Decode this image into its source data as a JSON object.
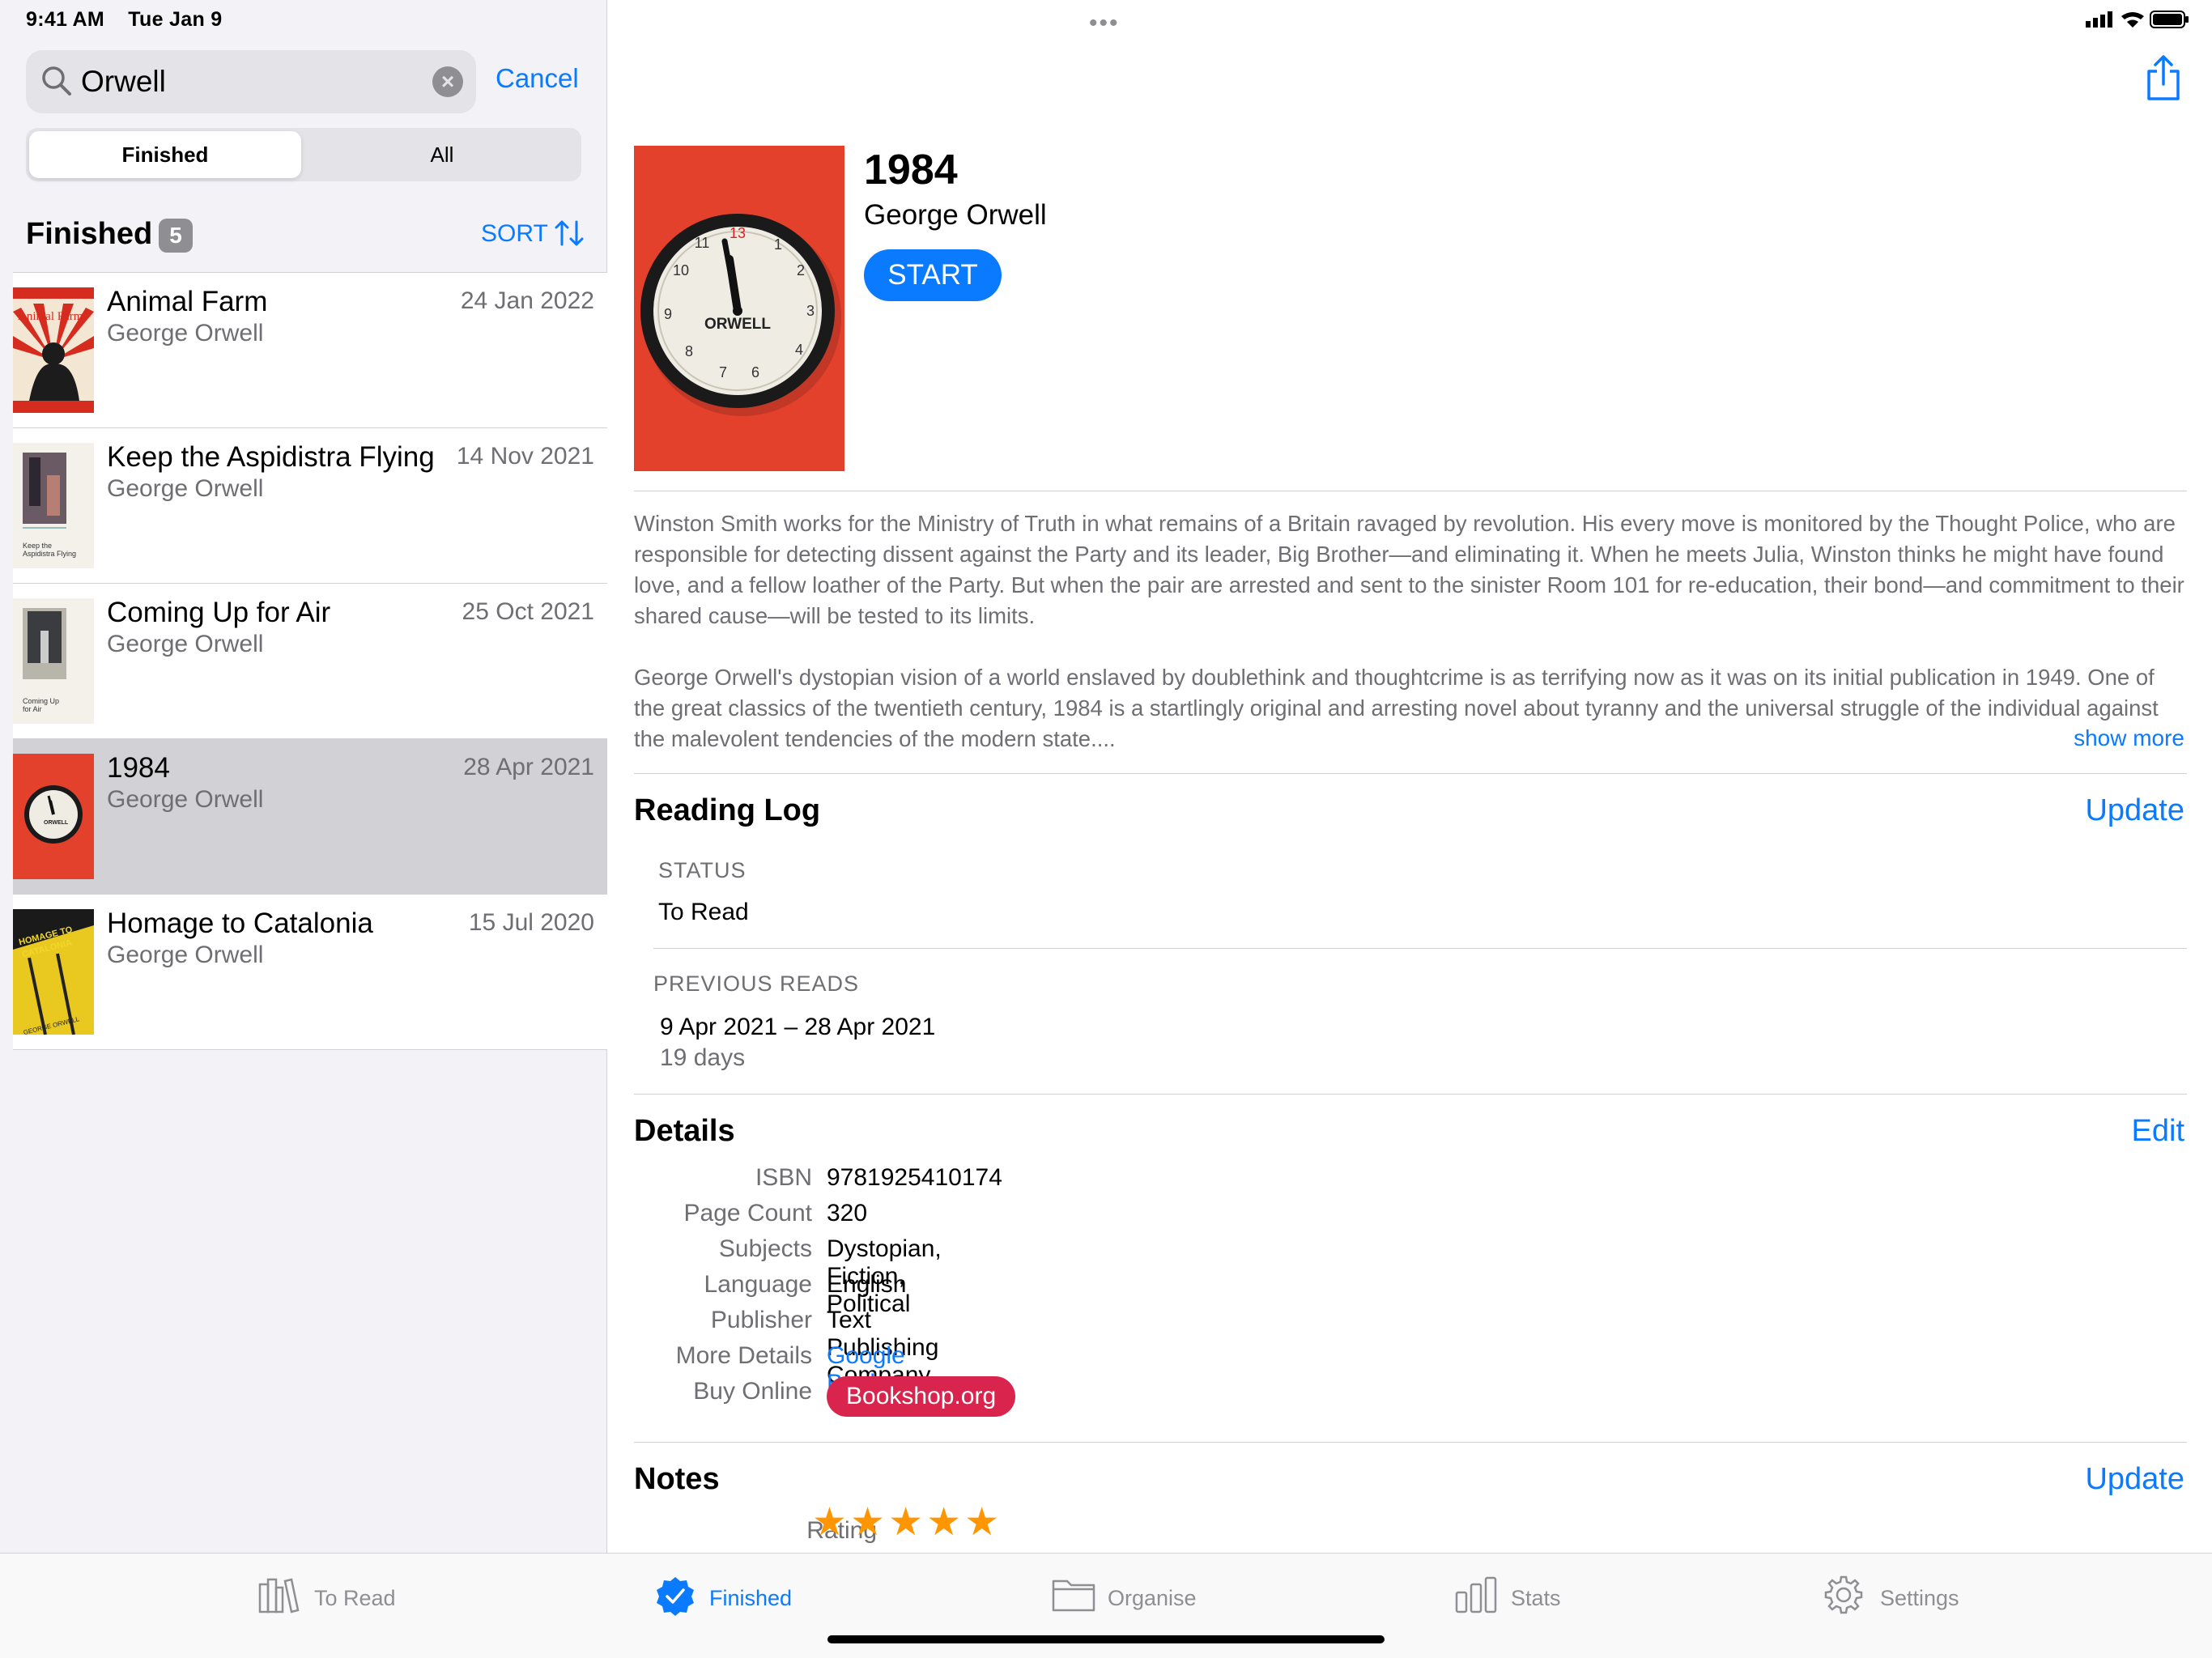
{
  "status_bar": {
    "time": "9:41 AM",
    "date": "Tue Jan 9"
  },
  "search": {
    "value": "Orwell",
    "cancel_label": "Cancel"
  },
  "segments": {
    "selected": "Finished",
    "other": "All"
  },
  "list": {
    "title": "Finished",
    "count": "5",
    "sort_label": "SORT",
    "books": [
      {
        "title": "Animal Farm",
        "author": "George Orwell",
        "date": "24 Jan 2022"
      },
      {
        "title": "Keep the Aspidistra Flying",
        "author": "George Orwell",
        "date": "14 Nov 2021"
      },
      {
        "title": "Coming Up for Air",
        "author": "George Orwell",
        "date": "25 Oct 2021"
      },
      {
        "title": "1984",
        "author": "George Orwell",
        "date": "28 Apr 2021"
      },
      {
        "title": "Homage to Catalonia",
        "author": "George Orwell",
        "date": "15 Jul 2020"
      }
    ]
  },
  "detail": {
    "title": "1984",
    "author": "George Orwell",
    "start_label": "START",
    "cover_text": "ORWELL",
    "description_1": "Winston Smith works for the Ministry of Truth in what remains of a Britain ravaged by revolution. His every move is monitored by the Thought Police, who are responsible for detecting dissent against the Party and its leader, Big Brother—and eliminating it. When he meets Julia, Winston thinks he might have found love, and a fellow loather of the Party. But when the pair are arrested and sent to the sinister Room 101 for re-education, their bond—and commitment to their shared cause—will be tested to its limits.",
    "description_2": "George Orwell's dystopian vision of a world enslaved by doublethink and thoughtcrime is as terrifying now as it was on its initial publication in 1949. One of the great classics of the twentieth century, 1984 is a startlingly original and arresting novel about tyranny and the universal struggle of the individual against the malevolent tendencies of the modern state....",
    "show_more": "show more",
    "reading_log": {
      "title": "Reading Log",
      "action": "Update",
      "status_caption": "STATUS",
      "status_value": "To Read",
      "previous_caption": "PREVIOUS READS",
      "previous_range": "9 Apr 2021 – 28 Apr 2021",
      "previous_days": "19 days"
    },
    "details": {
      "title": "Details",
      "action": "Edit",
      "isbn_label": "ISBN",
      "isbn": "9781925410174",
      "pages_label": "Page Count",
      "pages": "320",
      "subjects_label": "Subjects",
      "subjects": "Dystopian, Fiction, Political",
      "language_label": "Language",
      "language": "English",
      "publisher_label": "Publisher",
      "publisher": "Text Publishing Company",
      "more_label": "More Details",
      "more": "Google Books",
      "buy_label": "Buy Online",
      "buy": "Bookshop.org"
    },
    "notes": {
      "title": "Notes",
      "action": "Update",
      "rating_label": "Rating",
      "rating_stars": "★★★★★",
      "rating": 5
    }
  },
  "tabs": [
    {
      "label": "To Read",
      "icon": "books-icon"
    },
    {
      "label": "Finished",
      "icon": "checkmark-seal-icon",
      "active": true
    },
    {
      "label": "Organise",
      "icon": "folder-icon"
    },
    {
      "label": "Stats",
      "icon": "bar-chart-icon"
    },
    {
      "label": "Settings",
      "icon": "gear-icon"
    }
  ],
  "colors": {
    "accent": "#0a7aff",
    "bookshop": "#d9254e",
    "star": "#ff9500"
  }
}
